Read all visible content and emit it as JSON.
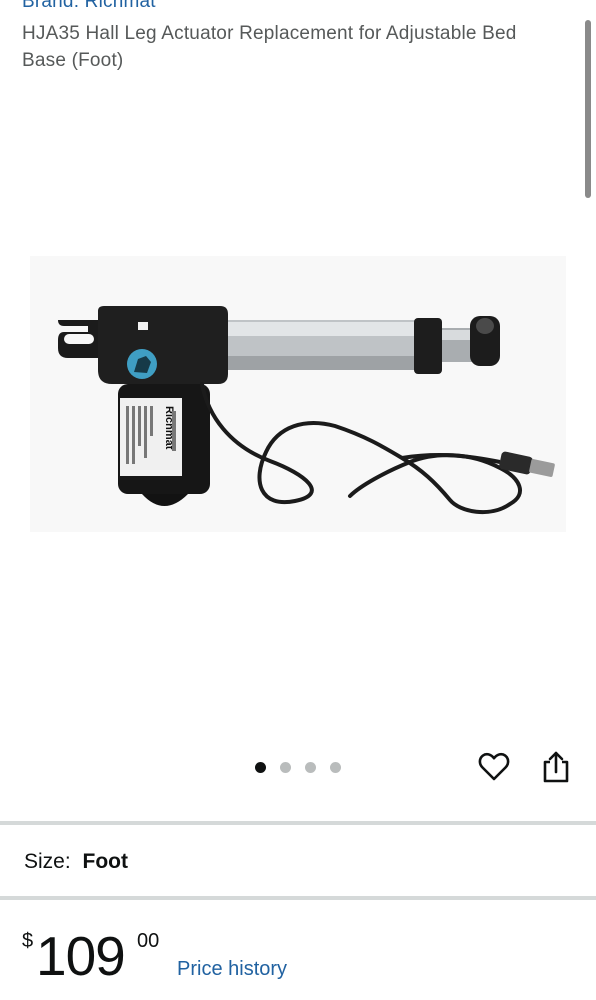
{
  "product": {
    "brand": "Brand: Richmat",
    "title": "HJA35 Hall Leg Actuator Replacement for Adjustable Bed Base (Foot)",
    "image_label": "Richmat",
    "image_alt": "Richmat linear actuator with motor and cable"
  },
  "gallery": {
    "image_count": 4,
    "active_index": 0
  },
  "actions": {
    "wishlist_icon": "heart-icon",
    "share_icon": "share-icon"
  },
  "size": {
    "label": "Size:",
    "value": "Foot"
  },
  "price": {
    "symbol": "$",
    "whole": "109",
    "fraction": "00",
    "history_link": "Price history"
  },
  "colors": {
    "link": "#2162a1",
    "text": "#0f1111",
    "muted": "#565959",
    "divider": "#d5d9d9"
  }
}
